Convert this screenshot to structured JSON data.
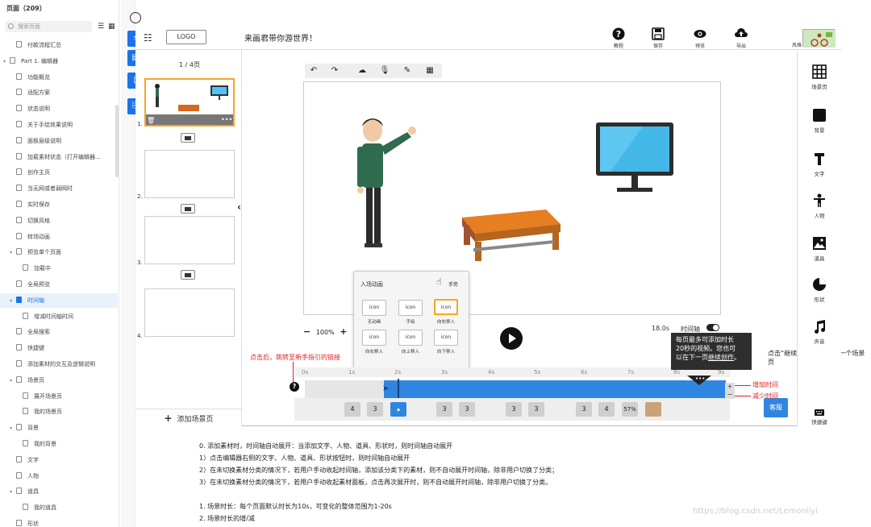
{
  "sidebar": {
    "title": "页面（209）",
    "search_placeholder": "搜索页面",
    "items": [
      {
        "label": "付款流程汇总",
        "indent": 1,
        "arrow": ""
      },
      {
        "label": "Part 1. 编辑器",
        "indent": 0,
        "arrow": "▾"
      },
      {
        "label": "功能概览",
        "indent": 1,
        "arrow": ""
      },
      {
        "label": "适配方案",
        "indent": 1,
        "arrow": ""
      },
      {
        "label": "状态说明",
        "indent": 1,
        "arrow": ""
      },
      {
        "label": "关于手绘效果说明",
        "indent": 1,
        "arrow": ""
      },
      {
        "label": "面板层级说明",
        "indent": 1,
        "arrow": ""
      },
      {
        "label": "加载素材状态（打开编辑器...",
        "indent": 1,
        "arrow": ""
      },
      {
        "label": "创作主页",
        "indent": 1,
        "arrow": ""
      },
      {
        "label": "当无网或者弱网时",
        "indent": 1,
        "arrow": ""
      },
      {
        "label": "实时保存",
        "indent": 1,
        "arrow": ""
      },
      {
        "label": "切换风格",
        "indent": 1,
        "arrow": ""
      },
      {
        "label": "转场动画",
        "indent": 1,
        "arrow": ""
      },
      {
        "label": "预览单个页面",
        "indent": 1,
        "arrow": "▾"
      },
      {
        "label": "加载中",
        "indent": 2,
        "arrow": ""
      },
      {
        "label": "全局预览",
        "indent": 1,
        "arrow": ""
      },
      {
        "label": "时间轴",
        "indent": 1,
        "arrow": "▾",
        "active": true
      },
      {
        "label": "增减时间轴时间",
        "indent": 2,
        "arrow": ""
      },
      {
        "label": "全局搜索",
        "indent": 1,
        "arrow": ""
      },
      {
        "label": "快捷键",
        "indent": 1,
        "arrow": ""
      },
      {
        "label": "添加素材的交互及逻辑说明",
        "indent": 1,
        "arrow": ""
      },
      {
        "label": "场景页",
        "indent": 1,
        "arrow": "▾"
      },
      {
        "label": "展开场景页",
        "indent": 2,
        "arrow": ""
      },
      {
        "label": "我的场景页",
        "indent": 2,
        "arrow": ""
      },
      {
        "label": "背景",
        "indent": 1,
        "arrow": "▾"
      },
      {
        "label": "我的背景",
        "indent": 2,
        "arrow": ""
      },
      {
        "label": "文字",
        "indent": 1,
        "arrow": ""
      },
      {
        "label": "人物",
        "indent": 1,
        "arrow": ""
      },
      {
        "label": "道具",
        "indent": 1,
        "arrow": "▾"
      },
      {
        "label": "我的道具",
        "indent": 2,
        "arrow": ""
      },
      {
        "label": "形状",
        "indent": 1,
        "arrow": ""
      }
    ]
  },
  "header": {
    "logo": "LOGO",
    "title": "来画君带你游世界！",
    "buttons": [
      {
        "label": "教程",
        "icon": "help-icon"
      },
      {
        "label": "保存",
        "icon": "save-icon"
      },
      {
        "label": "预览",
        "icon": "eye-icon"
      },
      {
        "label": "导出",
        "icon": "upload-icon"
      }
    ],
    "avatar_label": "风格"
  },
  "pages": {
    "counter": "1 / 4页",
    "numbers": [
      "1.",
      "2.",
      "3.",
      "4."
    ],
    "add_scene": "添加场景页"
  },
  "canvas": {
    "zoom": "100%",
    "duration": "18.0s",
    "timeline_toggle_label": "时间轴"
  },
  "anim_popup": {
    "title": "入场动画",
    "hand_label": "手势",
    "options": [
      {
        "text": "icon",
        "label": "无动画"
      },
      {
        "text": "icon",
        "label": "手绘"
      },
      {
        "text": "icon",
        "label": "向右移入",
        "selected": true
      },
      {
        "text": "icon",
        "label": "向右移入"
      },
      {
        "text": "icon",
        "label": "向上移入"
      },
      {
        "text": "icon",
        "label": "向下移入"
      }
    ]
  },
  "timeline": {
    "ticks": [
      "0s",
      "1s",
      "2s",
      "3s",
      "4s",
      "5s",
      "6s",
      "7s",
      "8s",
      "9s"
    ],
    "chips": [
      "4",
      "3",
      "",
      "3",
      "3",
      "3",
      "3",
      "3",
      "4",
      "57%",
      ""
    ],
    "plus": "+",
    "minus": "−",
    "help": "?"
  },
  "annotations": {
    "guide_link": "点击后，跳转至新手指引的链接",
    "add_time": "增加时间",
    "reduce_time": "减少时间",
    "tooltip_line1": "每页最多可添加时长",
    "tooltip_line2": "20秒的视频。您也可",
    "tooltip_line3": "以在下一页",
    "tooltip_link": "继续创作",
    "tooltip_end": "。",
    "right_note": "点击“继续创作”，则在下一个场景页"
  },
  "right_panel": [
    {
      "label": "场景页",
      "icon": "grid-icon"
    },
    {
      "label": "背景",
      "icon": "square-icon"
    },
    {
      "label": "文字",
      "icon": "text-icon"
    },
    {
      "label": "人物",
      "icon": "person-icon"
    },
    {
      "label": "道具",
      "icon": "image-icon"
    },
    {
      "label": "形状",
      "icon": "pie-icon"
    },
    {
      "label": "声音",
      "icon": "music-icon"
    },
    {
      "label": "快捷键",
      "icon": "keyboard-icon"
    }
  ],
  "kefu": "客服",
  "doc": {
    "lines": [
      "0. 添加素材时，时间轴自动展开：当添加文字、人物、道具、形状时，则时间轴自动展开",
      "1）点击编辑器右侧的文字、人物、道具、形状按钮时，则时间轴自动展开",
      "2）在未切换素材分类的情况下，若用户手动收起时间轴，添加该分类下的素材，则不自动展开时间轴，除非用户切换了分类；",
      "3）在未切换素材分类的情况下，若用户手动收起素材面板，点击再次展开时，则不自动展开时间轴，除非用户切换了分类。",
      "",
      "1. 场景时长：每个页面默认时长为10s，可变化的整体范围为1-20s",
      "2. 场景时长的增/减"
    ],
    "watermark": "https://blog.csdn.net/Lemonliyi"
  },
  "colors": {
    "accent": "#2f86e0",
    "tool_blue": "#1a73e8",
    "highlight": "#f5a623",
    "annotation_red": "#e02020"
  }
}
